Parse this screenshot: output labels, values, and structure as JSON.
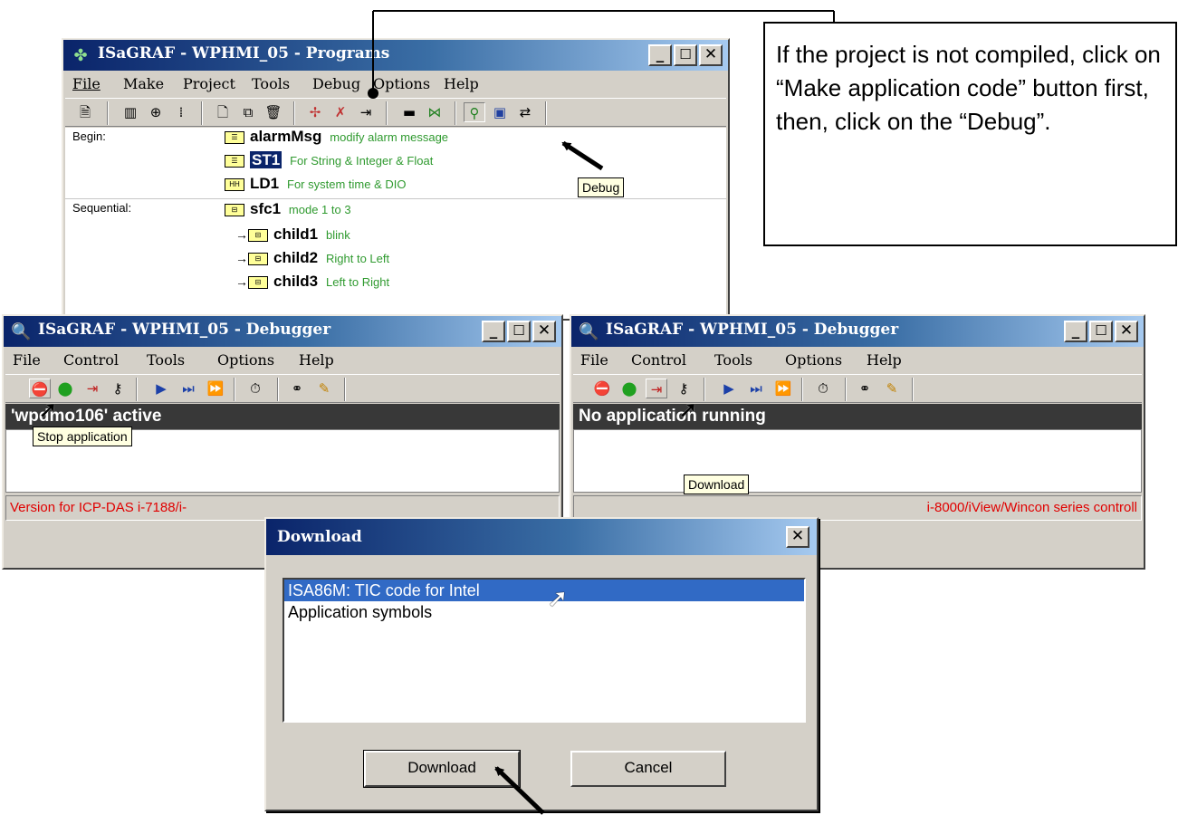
{
  "programs_window": {
    "title": "ISaGRAF - WPHMI_05 - Programs",
    "menu": [
      "File",
      "Make",
      "Project",
      "Tools",
      "Debug",
      "Options",
      "Help"
    ],
    "sections": [
      {
        "label": "Begin:",
        "programs": [
          {
            "name": "alarmMsg",
            "desc": "modify alarm message"
          },
          {
            "name": "ST1",
            "desc": "For String & Integer & Float"
          },
          {
            "name": "LD1",
            "desc": "For system time & DIO"
          }
        ]
      },
      {
        "label": "Sequential:",
        "programs": [
          {
            "name": "sfc1",
            "desc": "mode 1 to 3"
          },
          {
            "name": "child1",
            "desc": "blink"
          },
          {
            "name": "child2",
            "desc": "Right to Left"
          },
          {
            "name": "child3",
            "desc": "Left to Right"
          }
        ]
      }
    ],
    "tooltip": "Debug"
  },
  "debugger_left": {
    "title": "ISaGRAF - WPHMI_05 - Debugger",
    "menu": [
      "File",
      "Control",
      "Tools",
      "Options",
      "Help"
    ],
    "status": "'wpdmo106' active",
    "tooltip": "Stop application",
    "version": "Version for ICP-DAS i-7188/i-"
  },
  "debugger_right": {
    "title": "ISaGRAF - WPHMI_05 - Debugger",
    "menu": [
      "File",
      "Control",
      "Tools",
      "Options",
      "Help"
    ],
    "status": "No application running",
    "tooltip": "Download",
    "version": "i-8000/iView/Wincon series controll"
  },
  "download_dialog": {
    "title": "Download",
    "items": [
      "ISA86M: TIC code for Intel",
      "Application symbols"
    ],
    "selected_index": 0,
    "download_btn": "Download",
    "cancel_btn": "Cancel"
  },
  "callout": {
    "text": "If the project is not compiled, click on “Make application code” button first, then, click on the “Debug”."
  },
  "colors": {
    "titlebar": "#0a246a",
    "window_face": "#d4d0c8",
    "description_green": "#2f9a2f",
    "version_red": "#e00000",
    "selection": "#316ac5"
  }
}
